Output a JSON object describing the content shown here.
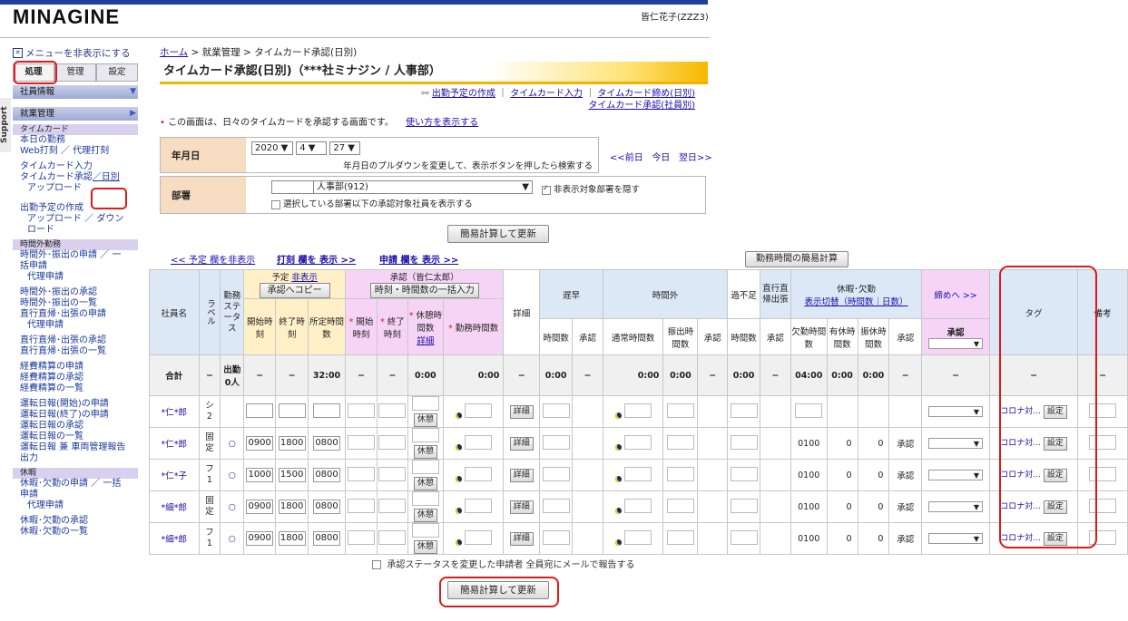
{
  "header": {
    "logo": "MINAGINE",
    "user": "皆仁花子(ZZZ3)"
  },
  "nav": {
    "hide_menu": "メニューを非表示にする",
    "tabs": [
      "処理",
      "管理",
      "設定"
    ],
    "section_emp": "社員情報",
    "section_work": "就業管理",
    "grp_timecard": "タイムカード",
    "tc_links": [
      "本日の勤務",
      "Web打刻 ／ 代理打刻",
      "タイムカード入力",
      "タイムカード承認",
      "／日別",
      "アップロード",
      "出勤予定の作成",
      "アップロード ／ ダウンロード"
    ],
    "grp_overtime": "時間外勤務",
    "ot_links": [
      "時間外･振出の申請 ／ 一括申請",
      "代理申請",
      "時間外･振出の承認",
      "時間外･振出の一覧",
      "直行直帰･出張の申請",
      "代理申請",
      "直行直帰･出張の承認",
      "直行直帰･出張の一覧",
      "経費精算の申請",
      "経費精算の承認",
      "経費精算の一覧",
      "運転日報(開始)の申請",
      "運転日報(終了)の申請",
      "運転日報の承認",
      "運転日報の一覧",
      "運転日報 兼 車両管理報告出力"
    ],
    "grp_leave": "休暇",
    "lv_links": [
      "休暇･欠勤の申請 ／ 一括申請",
      "代理申請",
      "休暇･欠勤の承認",
      "休暇･欠勤の一覧"
    ],
    "support": "Support"
  },
  "breadcrumb": {
    "home": "ホーム",
    "sep": ">",
    "l2": "就業管理",
    "l3": "タイムカード承認(日別)"
  },
  "page_title": "タイムカード承認(日別)（***社ミナジン / 人事部）",
  "right_links": [
    "出勤予定の作成",
    "タイムカード入力",
    "タイムカード締め(日別)",
    "タイムカード承認(社員別)"
  ],
  "desc": {
    "text": "この画面は、日々のタイムカードを承認する画面です。",
    "howto": "使い方を表示する"
  },
  "filter": {
    "date_label": "年月日",
    "year": "2020",
    "month": "4",
    "day": "27",
    "date_hint": "年月日のプルダウンを変更して、表示ボタンを押したら検索する",
    "prev": "<<前日",
    "today": "今日",
    "next": "翌日>>",
    "dept_label": "部署",
    "dept_value": "人事部(912)",
    "hide_dept": "非表示対象部署を隠す",
    "show_sub": "選択している部署以下の承認対象社員を表示する"
  },
  "buttons": {
    "calc_update": "簡易計算して更新",
    "simple_calc": "勤務時間の簡易計算"
  },
  "toggles": {
    "plan": "<< 予定 欄を非表示",
    "punch": "打刻 欄を 表示 >>",
    "apply": "申請 欄を 表示 >>"
  },
  "table": {
    "h_name": "社員名",
    "h_label": "ラベル",
    "h_status": "勤務ステータス",
    "h_plan": "予定",
    "h_plan_hide": "非表示",
    "h_plan_copy": "承認へコピー",
    "h_plan_cols": [
      "開始時刻",
      "終了時刻",
      "所定時間数"
    ],
    "h_app": "承認（皆仁太郎）",
    "h_app_bulk": "時刻・時間数の一括入力",
    "h_app_start": "開始時刻",
    "h_app_end": "終了時刻",
    "h_app_break": "休憩時間数",
    "h_app_break_link": "詳細",
    "h_app_work": "勤務時間数",
    "h_detail": "詳細",
    "h_late": "遅早",
    "h_ot": "時間外",
    "h_short": "過不足",
    "h_direct": "直行直帰出張",
    "h_leave": "休暇･欠勤",
    "h_leave_link": "表示切替（時間数｜日数）",
    "h_close": "締めへ >>",
    "h_close_app": "承認",
    "h_tag": "タグ",
    "h_memo": "備考",
    "h_hours": "時間数",
    "h_approve": "承認",
    "h_ot_normal": "通常時間数",
    "h_ot_shift": "振出時間数",
    "h_absent": "欠勤時間数",
    "h_paid": "有休時間数",
    "h_comp": "振休時間数",
    "total": {
      "label": "合計",
      "dash": "−",
      "status": "出勤",
      "count": "0人",
      "sched": "32:00",
      "zero": "0:00",
      "absent": "04:00",
      "zero2": "0:00"
    },
    "rows": [
      {
        "name": "*仁*郎",
        "label": "シ",
        "label2": "2",
        "status": "",
        "start": "",
        "end": "",
        "sched": "",
        "absent": "",
        "paid": "",
        "comp": "",
        "appr": ""
      },
      {
        "name": "*仁*郎",
        "label": "固",
        "label2": "定",
        "status": "○",
        "start": "0900",
        "end": "1800",
        "sched": "0800",
        "absent": "0100",
        "paid": "0",
        "comp": "0",
        "appr": "承認"
      },
      {
        "name": "*仁*子",
        "label": "フ",
        "label2": "1",
        "status": "○",
        "start": "1000",
        "end": "1500",
        "sched": "0800",
        "absent": "0100",
        "paid": "0",
        "comp": "0",
        "appr": "承認"
      },
      {
        "name": "*細*郎",
        "label": "固",
        "label2": "定",
        "status": "○",
        "start": "0900",
        "end": "1800",
        "sched": "0800",
        "absent": "0100",
        "paid": "0",
        "comp": "0",
        "appr": "承認"
      },
      {
        "name": "*細*郎",
        "label": "フ",
        "label2": "1",
        "status": "○",
        "start": "0900",
        "end": "1800",
        "sched": "0800",
        "absent": "0100",
        "paid": "0",
        "comp": "0",
        "appr": "承認"
      }
    ],
    "rest_btn": "休憩",
    "detail_btn": "詳細",
    "tag_text": "コロナ対...",
    "tag_btn": "設定"
  },
  "bottom": {
    "mail_cb": "承認ステータスを変更した申請者 全員宛にメールで報告する"
  }
}
